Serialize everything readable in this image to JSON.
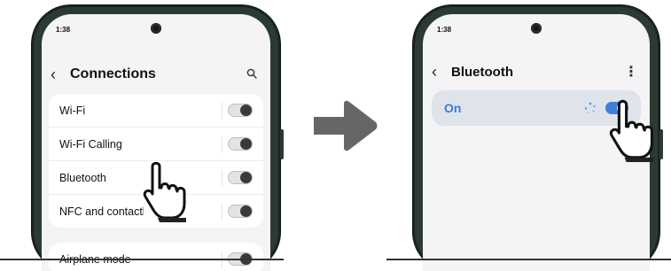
{
  "left_phone": {
    "time": "1:38",
    "title": "Connections",
    "back_icon": "chevron-left",
    "search_icon": "magnifier",
    "items": [
      {
        "label": "Wi-Fi"
      },
      {
        "label": "Wi-Fi Calling"
      },
      {
        "label": "Bluetooth"
      },
      {
        "label": "NFC and contactless payments"
      }
    ],
    "items2": [
      {
        "label": "Airplane mode"
      }
    ]
  },
  "arrow": {
    "icon": "right-arrow",
    "color": "#666666"
  },
  "right_phone": {
    "time": "1:38",
    "title": "Bluetooth",
    "back_icon": "chevron-left",
    "more_icon": "vertical-dots",
    "status_label": "On"
  },
  "colors": {
    "accent": "#3f7fe0",
    "phone_frame": "#2b3a33"
  }
}
